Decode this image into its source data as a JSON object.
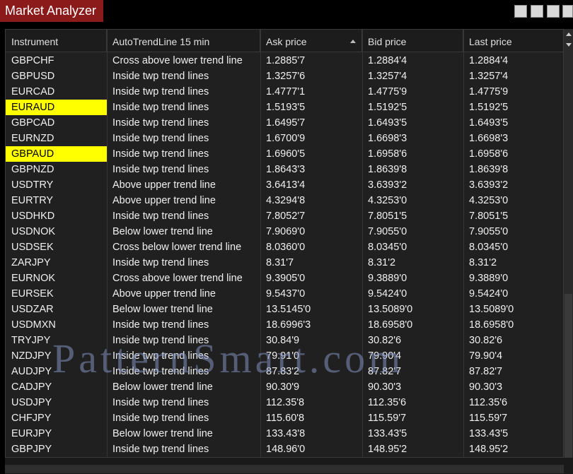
{
  "window": {
    "title": "Market Analyzer"
  },
  "header": {
    "instrument": "Instrument",
    "trend": "AutoTrendLine 15 min",
    "ask": "Ask price",
    "bid": "Bid price",
    "last": "Last price"
  },
  "highlight_color": "#ffff00",
  "watermark": "PatternSmart.com",
  "rows": [
    {
      "instrument": "GBPCHF",
      "trend": "Cross above lower trend line",
      "ask": "1.2885'7",
      "bid": "1.2884'4",
      "last": "1.2884'4",
      "highlight": false
    },
    {
      "instrument": "GBPUSD",
      "trend": "Inside twp trend lines",
      "ask": "1.3257'6",
      "bid": "1.3257'4",
      "last": "1.3257'4",
      "highlight": false
    },
    {
      "instrument": "EURCAD",
      "trend": "Inside twp trend lines",
      "ask": "1.4777'1",
      "bid": "1.4775'9",
      "last": "1.4775'9",
      "highlight": false
    },
    {
      "instrument": "EURAUD",
      "trend": "Inside twp trend lines",
      "ask": "1.5193'5",
      "bid": "1.5192'5",
      "last": "1.5192'5",
      "highlight": true
    },
    {
      "instrument": "GBPCAD",
      "trend": "Inside twp trend lines",
      "ask": "1.6495'7",
      "bid": "1.6493'5",
      "last": "1.6493'5",
      "highlight": false
    },
    {
      "instrument": "EURNZD",
      "trend": "Inside twp trend lines",
      "ask": "1.6700'9",
      "bid": "1.6698'3",
      "last": "1.6698'3",
      "highlight": false
    },
    {
      "instrument": "GBPAUD",
      "trend": "Inside twp trend lines",
      "ask": "1.6960'5",
      "bid": "1.6958'6",
      "last": "1.6958'6",
      "highlight": true
    },
    {
      "instrument": "GBPNZD",
      "trend": "Inside twp trend lines",
      "ask": "1.8643'3",
      "bid": "1.8639'8",
      "last": "1.8639'8",
      "highlight": false
    },
    {
      "instrument": "USDTRY",
      "trend": "Above upper trend line",
      "ask": "3.6413'4",
      "bid": "3.6393'2",
      "last": "3.6393'2",
      "highlight": false
    },
    {
      "instrument": "EURTRY",
      "trend": "Above upper trend line",
      "ask": "4.3294'8",
      "bid": "4.3253'0",
      "last": "4.3253'0",
      "highlight": false
    },
    {
      "instrument": "USDHKD",
      "trend": "Inside twp trend lines",
      "ask": "7.8052'7",
      "bid": "7.8051'5",
      "last": "7.8051'5",
      "highlight": false
    },
    {
      "instrument": "USDNOK",
      "trend": "Below lower trend line",
      "ask": "7.9069'0",
      "bid": "7.9055'0",
      "last": "7.9055'0",
      "highlight": false
    },
    {
      "instrument": "USDSEK",
      "trend": "Cross below lower trend line",
      "ask": "8.0360'0",
      "bid": "8.0345'0",
      "last": "8.0345'0",
      "highlight": false
    },
    {
      "instrument": "ZARJPY",
      "trend": "Inside twp trend lines",
      "ask": "8.31'7",
      "bid": "8.31'2",
      "last": "8.31'2",
      "highlight": false
    },
    {
      "instrument": "EURNOK",
      "trend": "Cross above lower trend line",
      "ask": "9.3905'0",
      "bid": "9.3889'0",
      "last": "9.3889'0",
      "highlight": false
    },
    {
      "instrument": "EURSEK",
      "trend": "Above upper trend line",
      "ask": "9.5437'0",
      "bid": "9.5424'0",
      "last": "9.5424'0",
      "highlight": false
    },
    {
      "instrument": "USDZAR",
      "trend": "Below lower trend line",
      "ask": "13.5145'0",
      "bid": "13.5089'0",
      "last": "13.5089'0",
      "highlight": false
    },
    {
      "instrument": "USDMXN",
      "trend": "Inside twp trend lines",
      "ask": "18.6996'3",
      "bid": "18.6958'0",
      "last": "18.6958'0",
      "highlight": false
    },
    {
      "instrument": "TRYJPY",
      "trend": "Inside twp trend lines",
      "ask": "30.84'9",
      "bid": "30.82'6",
      "last": "30.82'6",
      "highlight": false
    },
    {
      "instrument": "NZDJPY",
      "trend": "Inside twp trend lines",
      "ask": "79.91'0",
      "bid": "79.90'4",
      "last": "79.90'4",
      "highlight": false
    },
    {
      "instrument": "AUDJPY",
      "trend": "Inside twp trend lines",
      "ask": "87.83'2",
      "bid": "87.82'7",
      "last": "87.82'7",
      "highlight": false
    },
    {
      "instrument": "CADJPY",
      "trend": "Below lower trend line",
      "ask": "90.30'9",
      "bid": "90.30'3",
      "last": "90.30'3",
      "highlight": false
    },
    {
      "instrument": "USDJPY",
      "trend": "Inside twp trend lines",
      "ask": "112.35'8",
      "bid": "112.35'6",
      "last": "112.35'6",
      "highlight": false
    },
    {
      "instrument": "CHFJPY",
      "trend": "Inside twp trend lines",
      "ask": "115.60'8",
      "bid": "115.59'7",
      "last": "115.59'7",
      "highlight": false
    },
    {
      "instrument": "EURJPY",
      "trend": "Below lower trend line",
      "ask": "133.43'8",
      "bid": "133.43'5",
      "last": "133.43'5",
      "highlight": false
    },
    {
      "instrument": "GBPJPY",
      "trend": "Inside twp trend lines",
      "ask": "148.96'0",
      "bid": "148.95'2",
      "last": "148.95'2",
      "highlight": false
    }
  ]
}
